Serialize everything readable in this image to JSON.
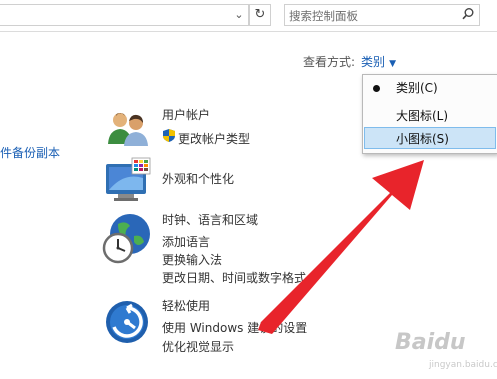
{
  "search": {
    "placeholder": "搜索控制面板"
  },
  "view_by": {
    "label": "查看方式:",
    "value": "类别"
  },
  "view_menu": {
    "items": [
      {
        "label": "类别(C)",
        "checked": true
      },
      {
        "label": "大图标(L)",
        "checked": false
      },
      {
        "label": "小图标(S)",
        "checked": false,
        "highlighted": true
      }
    ]
  },
  "left_partial_link": "件备份副本",
  "categories": [
    {
      "title": "用户帐户",
      "links": [
        "更改帐户类型"
      ],
      "icon": "users-icon"
    },
    {
      "title": "外观和个性化",
      "links": [],
      "icon": "appearance-icon"
    },
    {
      "title": "时钟、语言和区域",
      "links": [
        "添加语言",
        "更换输入法",
        "更改日期、时间或数字格式"
      ],
      "icon": "clock-globe-icon"
    },
    {
      "title": "轻松使用",
      "links": [
        "使用 Windows 建议的设置",
        "优化视觉显示"
      ],
      "icon": "ease-of-access-icon"
    }
  ],
  "watermark": {
    "text": "Baidu",
    "sub": "jingyan.baidu.com"
  },
  "colors": {
    "category_title": "#2d7a1f",
    "link": "#1a5fb4",
    "menu_highlight": "#cce4f7",
    "arrow": "#e8242b"
  }
}
